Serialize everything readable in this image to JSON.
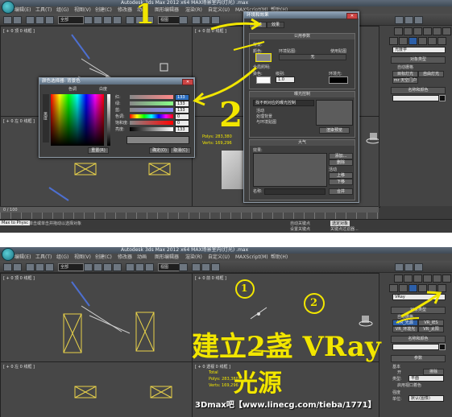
{
  "shot1": {
    "title": "Autodesk 3ds Max  2012 x64     MAX场景室内(灯光) .max",
    "menu": [
      "编辑(E)",
      "工具(T)",
      "组(G)",
      "视图(V)",
      "创建(C)",
      "修改器",
      "动画",
      "图形编辑器",
      "渲染(R)",
      "自定义(U)",
      "MAXScript(M)",
      "帮助(H)"
    ],
    "selection_filter": "全部",
    "view_select": "视图",
    "viewport_labels": {
      "top_left": "[ + 0 顶 0 线框 ]",
      "top_right": "[ + 0 前 0 线框 ]",
      "bottom_left": "[ + 0 左 0 线框 ]"
    },
    "env_dialog": {
      "title": "环境和效果",
      "tabs": [
        "环境",
        "效果"
      ],
      "common_params": "公用参数",
      "background": "背景:",
      "color_label": "颜色:",
      "env_map": "环境贴图:",
      "use_map": "使用贴图",
      "none": "无",
      "global_lighting": "全局照明:",
      "tint": "染色:",
      "level": "级别:",
      "level_value": "1.0",
      "ambient": "环境光:",
      "exposure_control": "曝光控制",
      "exposure_type": "找不到对应的曝光控制",
      "active": "活动",
      "process_bg": "处理背景",
      "and_env_map": "与环境贴图",
      "render_preview": "渲染预览",
      "atmosphere": "大气",
      "effects": "效果:",
      "add": "添加...",
      "delete": "删除",
      "active2": "活动",
      "move_up": "上移",
      "move_down": "下移",
      "merge": "合并",
      "name": "名称:"
    },
    "color_picker": {
      "title": "颜色选择器: 背景色",
      "hue": "色调",
      "whiteness": "白度",
      "blackness": "黑度",
      "labels": [
        "红:",
        "绿:",
        "蓝:",
        "色调:",
        "饱和度:",
        "亮度:"
      ],
      "values": [
        "133",
        "133",
        "133",
        "0",
        "0",
        "133"
      ],
      "reset": "重置(R)",
      "ok": "确定(O)",
      "cancel": "取消(C)"
    },
    "poly_info": {
      "polys": "Polys: 283,380",
      "verts": "Verts: 169,296"
    },
    "cmd": {
      "dropdown": "光度学",
      "object_type": "对象类型",
      "auto_grid": "自动栅格",
      "items": [
        "目标灯光",
        "自由灯光",
        "mr 天空门户"
      ],
      "name_color": "名称和颜色"
    },
    "status": {
      "prompt": "Max to Physc",
      "hint": "单击或单击并拖动以选择对象",
      "auto_key": "自动关键点",
      "set_key": "设置关键点",
      "filter": "关键点过滤器...",
      "selected": "选定对象",
      "time": "0 / 100"
    },
    "annotations": {
      "mark1": "1",
      "mark2": "2"
    }
  },
  "shot2": {
    "title": "Autodesk 3ds Max  2012 x64     MAX场景室内(灯光) .max",
    "menu": [
      "编辑(E)",
      "工具(T)",
      "组(G)",
      "视图(V)",
      "创建(C)",
      "修改器",
      "动画",
      "图形编辑器",
      "渲染(R)",
      "自定义(U)",
      "MAXScript(M)",
      "帮助(H)"
    ],
    "selection_filter": "全部",
    "view_select": "视图",
    "viewport_labels": {
      "top_left": "[ + 0 顶 0 线框 ]",
      "top_right": "[ + 0 前 0 线框 ]",
      "bottom_left": "[ + 0 左 0 线框 ]",
      "bottom_right": "[ + 0 透视 0 线框 ]"
    },
    "stats": {
      "total": "Total",
      "polys": "Polys: 283,380",
      "verts": "Verts: 169,296"
    },
    "cmd": {
      "dropdown": "VRay",
      "object_type": "对象类型",
      "auto_grid": "自动栅格",
      "items": [
        "VR_光源",
        "VR_IES",
        "VR_环境光",
        "VR_太阳"
      ],
      "name_color": "名称和颜色",
      "params": "参数",
      "basic": "基本",
      "on": "开",
      "exclude": "排除",
      "type_label": "类型:",
      "type_value": "平面",
      "enable_vp": "启用视口着色",
      "intensity": "强度",
      "units_label": "单位:",
      "units_value": "默认(图像)"
    },
    "annotations": {
      "circle1": "1",
      "circle2": "2",
      "handwriting_line1": "建立2盏 VRay",
      "handwriting_line2": "光源"
    }
  },
  "watermark": "3Dmax吧【www.linecg.com/tieba/1771】",
  "colors": {
    "annotation_yellow": "#f2e600",
    "viewport_bg": "#474747",
    "panel_bg": "#444444",
    "selection_blue": "#2c5fa8"
  }
}
